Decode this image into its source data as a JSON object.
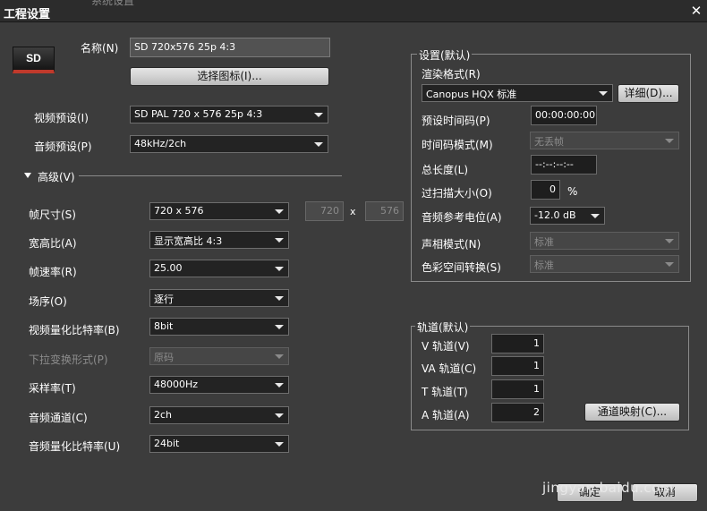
{
  "window": {
    "title": "工程设置",
    "ghost_tab": "系统设置",
    "close_glyph": "✕"
  },
  "project": {
    "icon_text": "SD",
    "name_label": "名称(N)",
    "name_value": "SD 720x576 25p 4:3",
    "select_icon_button": "选择图标(I)...",
    "video_preset_label": "视频预设(I)",
    "video_preset_value": "SD PAL 720 x 576 25p 4:3",
    "audio_preset_label": "音频预设(P)",
    "audio_preset_value": "48kHz/2ch"
  },
  "advanced": {
    "section_label": "高级(V)",
    "frame_size_label": "帧尺寸(S)",
    "frame_size_value": "720 x 576",
    "frame_width": "720",
    "frame_x": "x",
    "frame_height": "576",
    "aspect_label": "宽高比(A)",
    "aspect_value": "显示宽高比 4:3",
    "frame_rate_label": "帧速率(R)",
    "frame_rate_value": "25.00",
    "field_order_label": "场序(O)",
    "field_order_value": "逐行",
    "video_bit_label": "视频量化比特率(B)",
    "video_bit_value": "8bit",
    "pulldown_label": "下拉变换形式(P)",
    "pulldown_value": "原码",
    "sample_rate_label": "采样率(T)",
    "sample_rate_value": "48000Hz",
    "audio_channels_label": "音频通道(C)",
    "audio_channels_value": "2ch",
    "audio_bit_label": "音频量化比特率(U)",
    "audio_bit_value": "24bit"
  },
  "settings_group": {
    "title": "设置(默认)",
    "render_format_label": "渲染格式(R)",
    "render_format_value": "Canopus HQX 标准",
    "detail_button": "详细(D)...",
    "preset_timecode_label": "预设时间码(P)",
    "preset_timecode_value": "00:00:00:00",
    "timecode_mode_label": "时间码模式(M)",
    "timecode_mode_value": "无丢帧",
    "total_length_label": "总长度(L)",
    "total_length_value": "--:--:--:--",
    "overscan_label": "过扫描大小(O)",
    "overscan_value": "0",
    "overscan_unit": "%",
    "audio_ref_label": "音频参考电位(A)",
    "audio_ref_value": "-12.0 dB",
    "phase_mode_label": "声相模式(N)",
    "phase_mode_value": "标准",
    "color_space_label": "色彩空间转换(S)",
    "color_space_value": "标准"
  },
  "tracks_group": {
    "title": "轨道(默认)",
    "v_label": "V 轨道(V)",
    "v_value": "1",
    "va_label": "VA 轨道(C)",
    "va_value": "1",
    "t_label": "T 轨道(T)",
    "t_value": "1",
    "a_label": "A 轨道(A)",
    "a_value": "2",
    "channel_map_button": "通道映射(C)..."
  },
  "footer": {
    "ok_button": "确定",
    "cancel_button": "取消",
    "watermark": "jingyan.baidu.com"
  }
}
